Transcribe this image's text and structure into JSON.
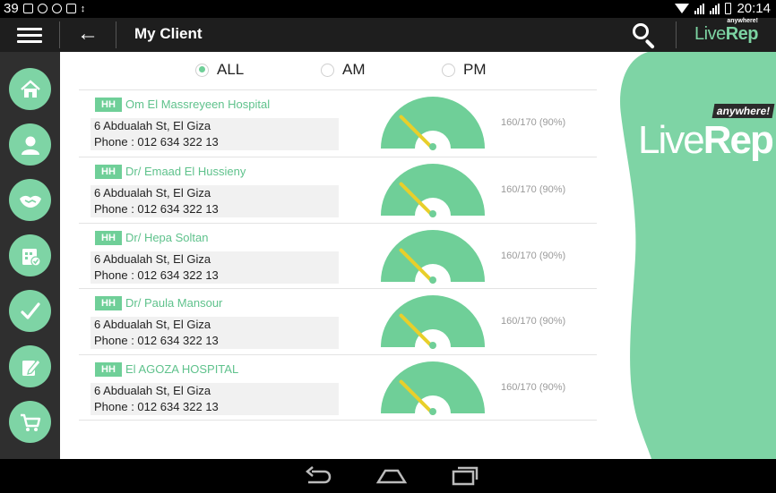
{
  "status_bar": {
    "notification_count": "39",
    "time": "20:14",
    "left_icons": [
      "image-icon",
      "circle-icon",
      "android-icon",
      "check-icon",
      "usb-icon"
    ],
    "right_icons": [
      "wifi-icon",
      "signal-icon",
      "signal-icon",
      "battery-icon"
    ]
  },
  "app_bar": {
    "title": "My Client",
    "brand_live": "Live",
    "brand_rep": "Rep",
    "brand_tag": "anywhere!"
  },
  "sidebar": {
    "items": [
      {
        "name": "home",
        "icon": "home-icon"
      },
      {
        "name": "clients",
        "icon": "user-icon"
      },
      {
        "name": "handshake",
        "icon": "handshake-icon"
      },
      {
        "name": "calendar",
        "icon": "calendar-check-icon"
      },
      {
        "name": "approvals",
        "icon": "checkmark-icon"
      },
      {
        "name": "notes",
        "icon": "edit-icon"
      },
      {
        "name": "orders",
        "icon": "cart-icon"
      }
    ]
  },
  "filters": {
    "options": [
      "ALL",
      "AM",
      "PM"
    ],
    "selected": "ALL"
  },
  "clients": [
    {
      "badge": "HH",
      "name": "Om El Massreyeen Hospital",
      "address": "6 Abdualah St, El Giza",
      "phone": "Phone : 012 634 322 13",
      "ratio": "160/170 (90%)",
      "progress": 0.9
    },
    {
      "badge": "HH",
      "name": "Dr/ Emaad El Hussieny",
      "address": "6 Abdualah St, El Giza",
      "phone": "Phone : 012 634 322 13",
      "ratio": "160/170 (90%)",
      "progress": 0.9
    },
    {
      "badge": "HH",
      "name": "Dr/ Hepa Soltan",
      "address": "6 Abdualah St, El Giza",
      "phone": "Phone : 012 634 322 13",
      "ratio": "160/170 (90%)",
      "progress": 0.9
    },
    {
      "badge": "HH",
      "name": "Dr/ Paula Mansour",
      "address": "6 Abdualah St, El Giza",
      "phone": "Phone : 012 634 322 13",
      "ratio": "160/170 (90%)",
      "progress": 0.9
    },
    {
      "badge": "HH",
      "name": "El AGOZA HOSPITAL",
      "address": "6 Abdualah St, El Giza",
      "phone": "Phone : 012 634 322 13",
      "ratio": "160/170 (90%)",
      "progress": 0.9
    }
  ],
  "colors": {
    "accent": "#6fcf98",
    "sidebar": "#2f2f2f",
    "appbar": "#1e1e1e",
    "needle": "#e8cf2b"
  }
}
